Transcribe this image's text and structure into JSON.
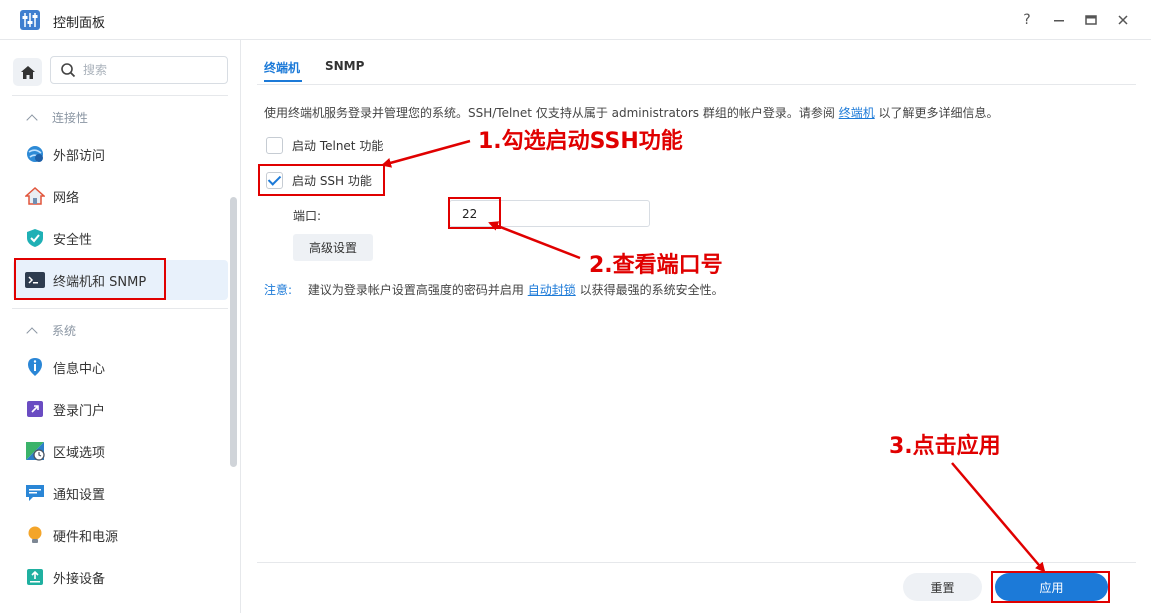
{
  "window": {
    "title": "控制面板",
    "controls": {
      "help": "?",
      "minimize": "—",
      "maximize": "▭",
      "close": "✕"
    }
  },
  "sidebar": {
    "search_placeholder": "搜索",
    "sections": [
      {
        "label": "连接性"
      },
      {
        "label": "系统"
      }
    ],
    "items": [
      {
        "label": "外部访问",
        "icon": "external-access-icon"
      },
      {
        "label": "网络",
        "icon": "network-house-icon"
      },
      {
        "label": "安全性",
        "icon": "shield-icon"
      },
      {
        "label": "终端机和 SNMP",
        "icon": "terminal-icon"
      },
      {
        "label": "信息中心",
        "icon": "info-icon"
      },
      {
        "label": "登录门户",
        "icon": "login-portal-icon"
      },
      {
        "label": "区域选项",
        "icon": "regional-options-icon"
      },
      {
        "label": "通知设置",
        "icon": "notification-icon"
      },
      {
        "label": "硬件和电源",
        "icon": "lightbulb-icon"
      },
      {
        "label": "外接设备",
        "icon": "external-device-icon"
      }
    ]
  },
  "tabs": [
    {
      "label": "终端机",
      "active": true
    },
    {
      "label": "SNMP",
      "active": false
    }
  ],
  "main": {
    "description": "使用终端机服务登录并管理您的系统。SSH/Telnet 仅支持从属于 administrators 群组的帐户登录。请参阅",
    "description_link": "终端机",
    "description_suffix": "以了解更多详细信息。",
    "telnet_label": "启动 Telnet 功能",
    "telnet_checked": false,
    "ssh_label": "启动 SSH 功能",
    "ssh_checked": true,
    "port_label": "端口:",
    "port_value": "22",
    "advanced_button": "高级设置",
    "note_label": "注意:",
    "note_text": "建议为登录帐户设置高强度的密码并启用",
    "note_link": "自动封锁",
    "note_suffix": "以获得最强的系统安全性。"
  },
  "footer": {
    "reset_button": "重置",
    "apply_button": "应用"
  },
  "annotations": {
    "step1": "1.勾选启动SSH功能",
    "step2": "2.查看端口号",
    "step3": "3.点击应用",
    "color": "#e00000"
  },
  "colors": {
    "accent": "#1c7ad8",
    "annotation": "#e00000"
  }
}
